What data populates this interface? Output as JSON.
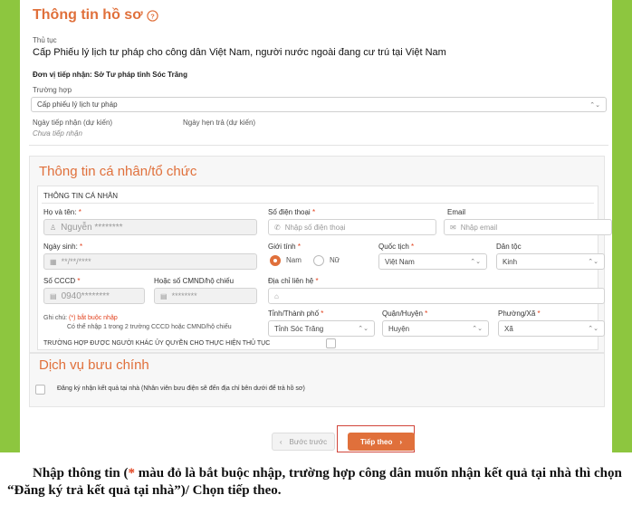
{
  "section_title": "Thông tin hồ sơ",
  "procedure": {
    "label": "Thủ tục",
    "value": "Cấp Phiếu lý lịch tư pháp cho công dân Việt Nam, người nước ngoài đang cư trú tại Việt Nam"
  },
  "receiver": "Đơn vị tiếp nhận: Sở Tư pháp tỉnh Sóc Trăng",
  "case": {
    "label": "Trường hợp",
    "value": "Cấp phiếu lý lịch tư pháp"
  },
  "dates": {
    "received_label": "Ngày tiếp nhận (dự kiến)",
    "received_value": "Chưa tiếp nhận",
    "return_label": "Ngày hẹn trả (dự kiến)"
  },
  "personal": {
    "heading": "Thông tin cá nhân/tổ chức",
    "subheading": "THÔNG TIN CÁ NHÂN",
    "name_label": "Họ và tên:",
    "name_value": "Nguyễn ********",
    "phone_label": "Số điện thoại",
    "phone_placeholder": "Nhập số điện thoại",
    "email_label": "Email",
    "email_placeholder": "Nhập email",
    "dob_label": "Ngày sinh:",
    "dob_value": "**/**/****",
    "gender_label": "Giới tính",
    "gender_male": "Nam",
    "gender_female": "Nữ",
    "nationality_label": "Quốc tịch",
    "nationality_value": "Việt Nam",
    "ethnic_label": "Dân tộc",
    "ethnic_value": "Kinh",
    "cccd_label": "Số CCCD",
    "cccd_value": "0940********",
    "cmnd_label": "Hoặc số CMND/hộ chiếu",
    "cmnd_value": "********",
    "address_label": "Địa chỉ liên hệ",
    "province_label": "Tỉnh/Thành phố",
    "province_value": "Tỉnh Sóc Trăng",
    "district_label": "Quận/Huyện",
    "district_value": "Huyện",
    "ward_label": "Phường/Xã",
    "ward_value": "Xã",
    "note_prefix": "Ghi chú:",
    "note_required": "(*) bắt buộc nhập",
    "note_line2": "Có thể nhập 1 trong 2 trường CCCD hoặc CMND/hộ chiếu",
    "authorized_label": "TRƯỜNG HỢP ĐƯỢC NGƯỜI KHÁC ỦY QUYỀN CHO THỰC HIỆN THỦ TỤC"
  },
  "postal": {
    "heading": "Dịch vụ bưu chính",
    "checkbox_label": "Đăng ký nhận kết quả tại nhà (Nhân viên bưu điện sẽ đến địa chỉ bên dưới để trả hồ sơ)"
  },
  "buttons": {
    "back": "Bước trước",
    "next": "Tiếp theo"
  },
  "caption": {
    "part1": "Nhập thông tin (",
    "star": "*",
    "part2": " màu đỏ là bắt buộc nhập, trường hợp công dân muốn nhận kết quả tại nhà thì chọn “Đăng ký trả kết quả tại nhà”)/ Chọn tiếp theo."
  },
  "colors": {
    "accent": "#e0703b",
    "frame": "#8dc63f",
    "required": "#e2401c"
  }
}
